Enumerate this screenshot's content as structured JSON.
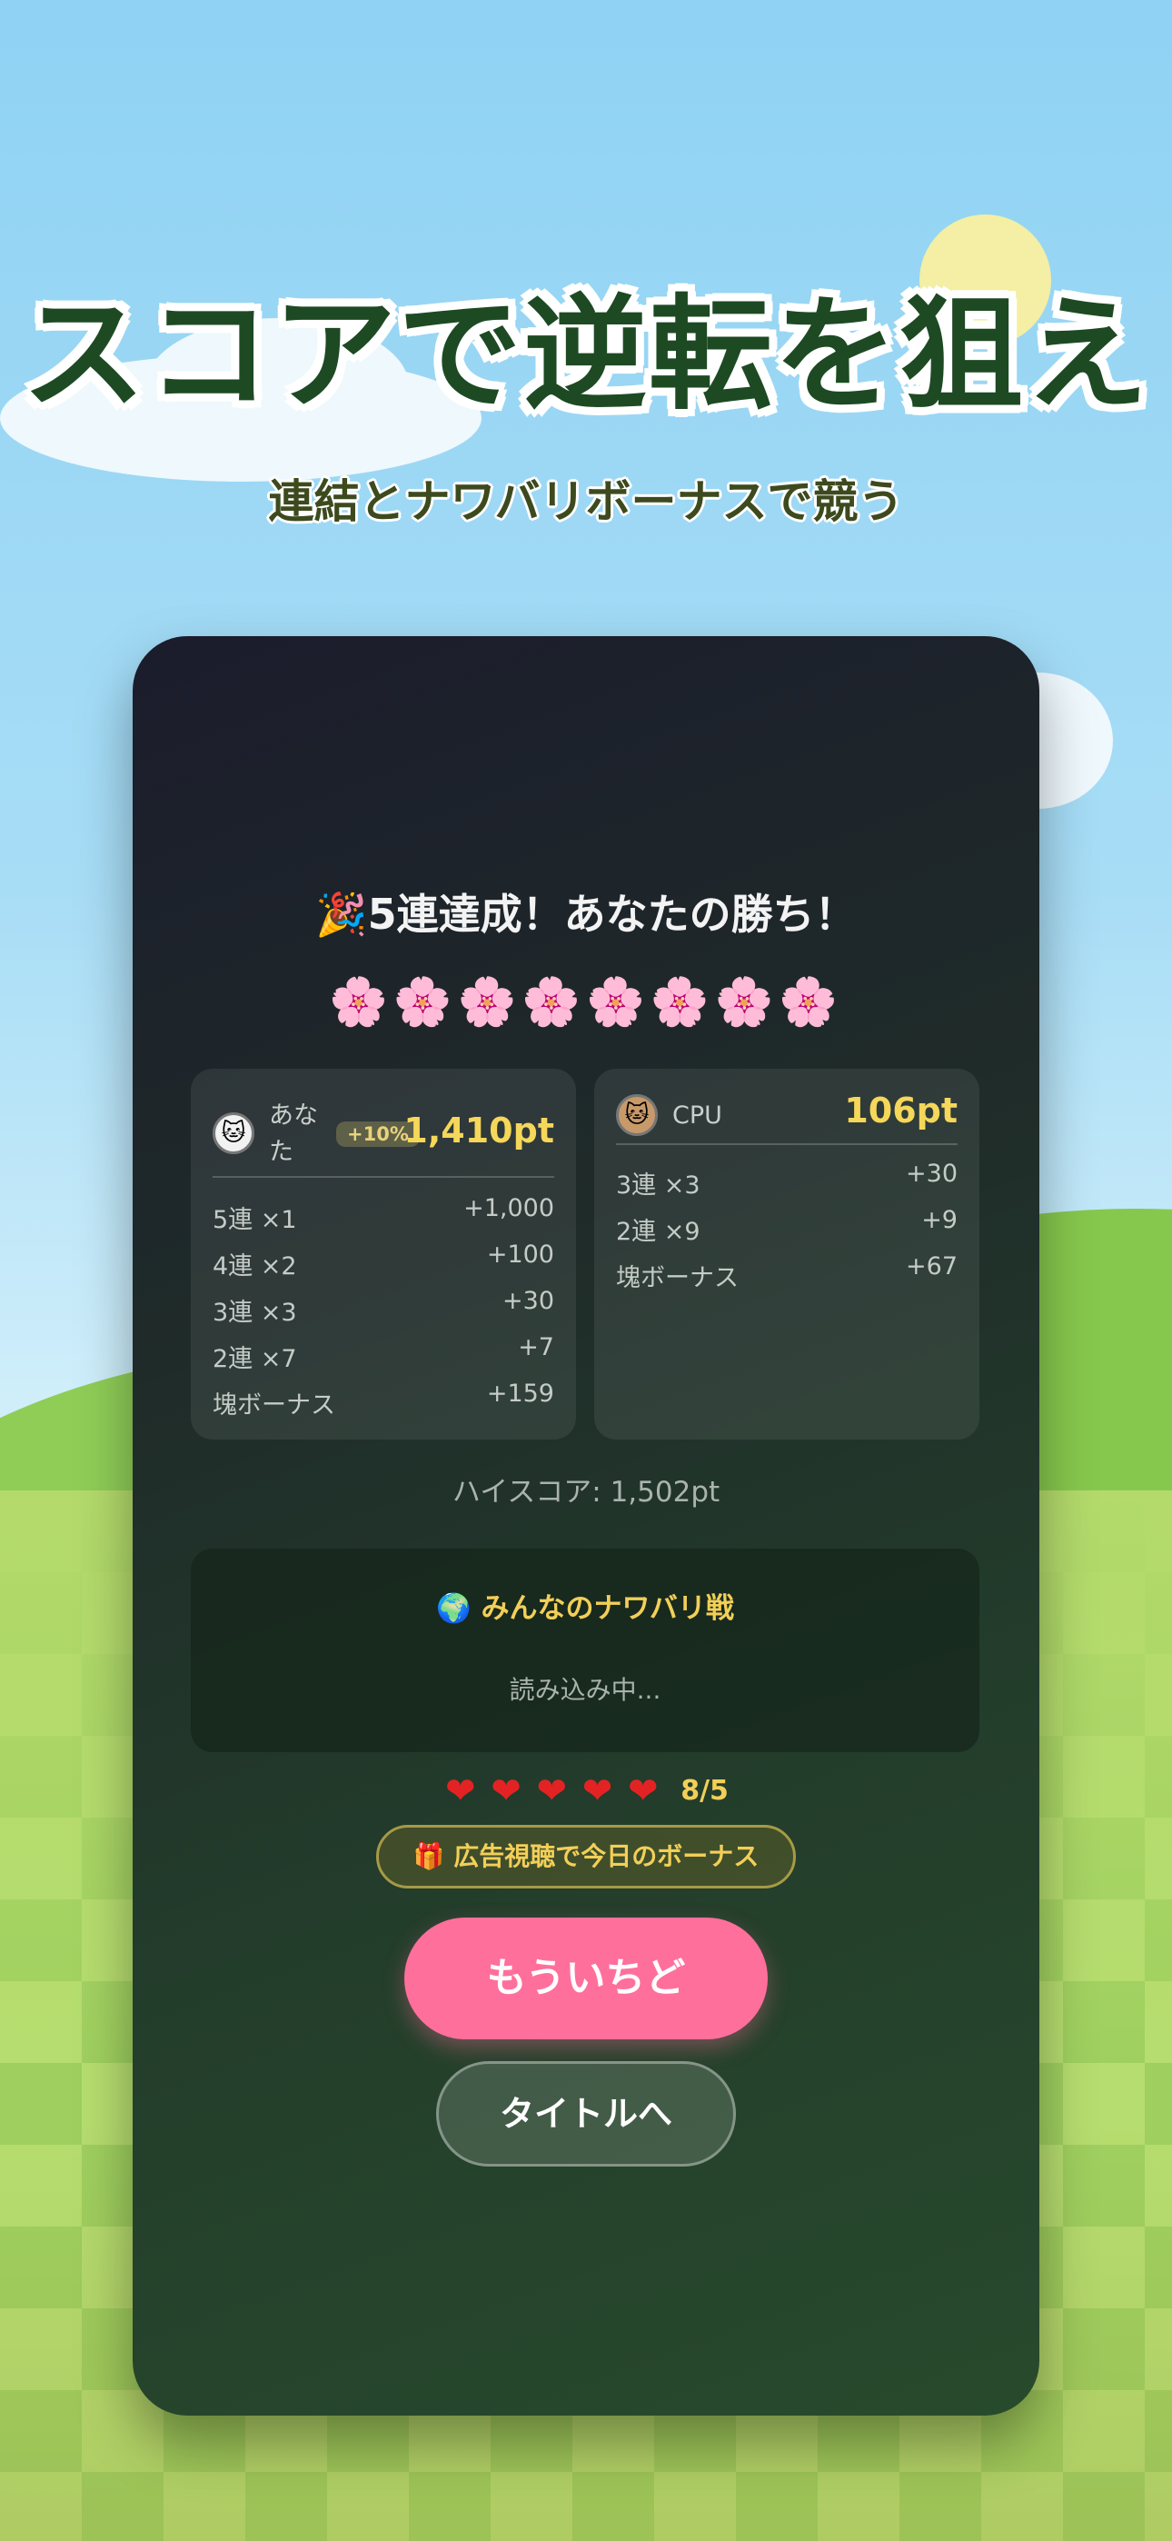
{
  "promo": {
    "headline": "スコアで逆転を狙え",
    "subheadline": "連結とナワバリボーナスで競う"
  },
  "result": {
    "title": "🎉5連達成！あなたの勝ち！",
    "flowers": "🌸🌸🌸🌸🌸🌸🌸🌸"
  },
  "player": {
    "avatar": "🐱",
    "name": "あなた",
    "bonus_badge": "+10%",
    "total": "1,410pt",
    "rows": [
      {
        "label": "5連 ×1",
        "value": "+1,000"
      },
      {
        "label": "4連 ×2",
        "value": "+100"
      },
      {
        "label": "3連 ×3",
        "value": "+30"
      },
      {
        "label": "2連 ×7",
        "value": "+7"
      },
      {
        "label": "塊ボーナス",
        "value": "+159"
      }
    ]
  },
  "cpu": {
    "avatar": "🐱",
    "name": "CPU",
    "total": "106pt",
    "rows": [
      {
        "label": "3連 ×3",
        "value": "+30"
      },
      {
        "label": "2連 ×9",
        "value": "+9"
      },
      {
        "label": "塊ボーナス",
        "value": "+67"
      }
    ]
  },
  "highscore": "ハイスコア: 1,502pt",
  "world_panel": {
    "title": "🌍 みんなのナワバリ戦",
    "loading": "読み込み中..."
  },
  "lives": {
    "heart": "❤",
    "count_text": "8/5",
    "hearts_shown": 5
  },
  "buttons": {
    "ad_bonus": "🎁 広告視聴で今日のボーナス",
    "retry": "もういちど",
    "to_title": "タイトルへ"
  }
}
